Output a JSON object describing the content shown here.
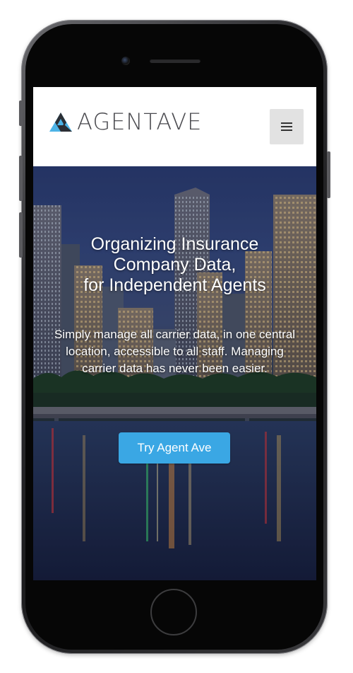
{
  "brand": {
    "name": "AGENTAVE",
    "logo_icon": "triangle-a-logo-icon"
  },
  "navbar": {
    "menu_icon": "hamburger-menu-icon"
  },
  "hero": {
    "title_lines": [
      "Organizing Insurance",
      "Company Data,",
      "for Independent Agents"
    ],
    "description": "Simply manage all carrier data, in one central location, accessible to all staff. Managing carrier data has never been easier.",
    "cta_label": "Try Agent Ave"
  },
  "colors": {
    "cta": "#3aa7e4",
    "logo_light_blue": "#4db3e6",
    "logo_dark": "#2c2f35",
    "menu_button_bg": "#e2e2e2"
  }
}
